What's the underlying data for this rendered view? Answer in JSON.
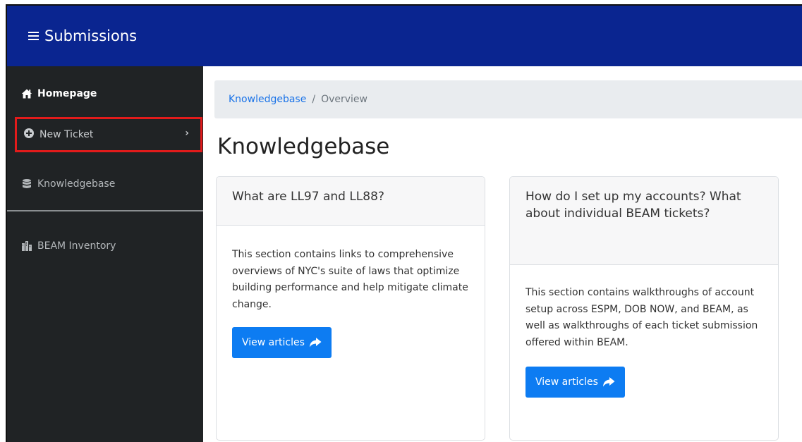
{
  "header": {
    "title": "Submissions"
  },
  "sidebar": {
    "items": [
      {
        "label": "Homepage",
        "icon": "home-icon"
      },
      {
        "label": "New Ticket",
        "icon": "plus-circle-icon"
      },
      {
        "label": "Knowledgebase",
        "icon": "database-icon"
      },
      {
        "label": "BEAM Inventory",
        "icon": "buildings-icon"
      }
    ],
    "highlight_color": "#e21b1b"
  },
  "breadcrumb": {
    "root": "Knowledgebase",
    "separator": "/",
    "current": "Overview"
  },
  "page": {
    "title": "Knowledgebase"
  },
  "cards": [
    {
      "title": "What are LL97 and LL88?",
      "body": "This section contains links to comprehensive overviews of NYC's suite of laws that optimize building performance and help mitigate climate change.",
      "button_label": "View articles"
    },
    {
      "title": "How do I set up my accounts? What about individual BEAM tickets?",
      "body": "This section contains walkthroughs of account setup across ESPM, DOB NOW, and BEAM, as well as walkthroughs of each ticket submission offered within BEAM.",
      "button_label": "View articles"
    }
  ],
  "colors": {
    "topbar": "#0a2590",
    "sidebar": "#202325",
    "button": "#0d7cf2",
    "link": "#1a73e8"
  }
}
